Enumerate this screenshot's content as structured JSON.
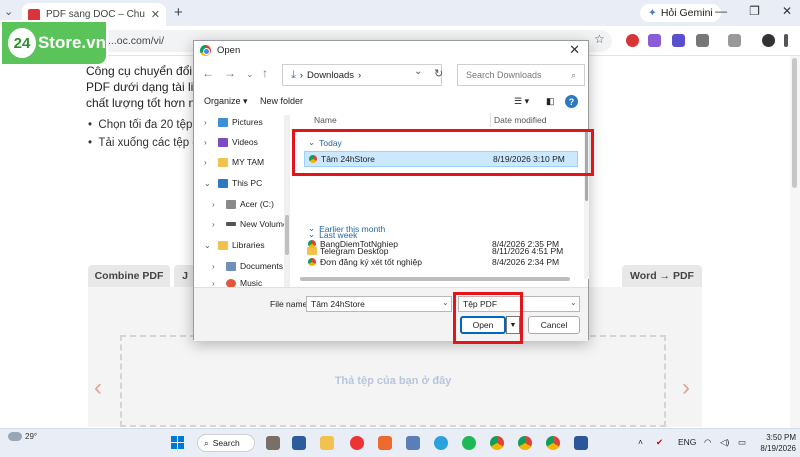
{
  "browser": {
    "tab_title": "PDF sang DOC – Chuyển đổi PDF",
    "url": "...oc.com/vi/",
    "gemini_label": "Hỏi Gemini"
  },
  "logo": {
    "number": "24",
    "text": "Store.vn"
  },
  "page": {
    "intro_lines": [
      "Công cụ chuyển đổi P",
      "PDF dưới dạng tài liệ",
      "chất lượng tốt hơn nh"
    ],
    "bullets": [
      "Chọn tối đa 20 tệp I",
      "Tải xuống các tệp đ"
    ],
    "tabs": {
      "combine": "Combine PDF",
      "partial": "J",
      "word_pdf": "Word → PDF"
    },
    "dropzone_text": "Thả tệp của bạn ở đây"
  },
  "dialog": {
    "title": "Open",
    "address": "Downloads",
    "search_placeholder": "Search Downloads",
    "organize": "Organize",
    "new_folder": "New folder",
    "tree": [
      "Pictures",
      "Videos",
      "MY TAM",
      "This PC",
      "Acer (C:)",
      "New Volume",
      "Libraries",
      "Documents",
      "Music"
    ],
    "columns": {
      "name": "Name",
      "date": "Date modified"
    },
    "groups": {
      "today": "Today",
      "last_week": "Last week",
      "earlier": "Earlier this month"
    },
    "files": [
      {
        "name": "Tâm 24hStore",
        "date": "8/19/2026 3:10 PM",
        "selected": true,
        "kind": "chrome"
      },
      {
        "name": "Telegram Desktop",
        "date": "8/11/2026 4:51 PM",
        "selected": false,
        "kind": "folder"
      },
      {
        "name": "BangDiemTotNghiep",
        "date": "8/4/2026 2:35 PM",
        "selected": false,
        "kind": "chrome"
      },
      {
        "name": "Đơn đăng ký xét tốt nghiệp",
        "date": "8/4/2026 2:34 PM",
        "selected": false,
        "kind": "chrome"
      }
    ],
    "file_name_label": "File name:",
    "file_name_value": "Tâm 24hStore",
    "file_type": "Tệp PDF",
    "open_label": "Open",
    "cancel_label": "Cancel"
  },
  "taskbar": {
    "weather": "29°",
    "search": "Search",
    "lang": "ENG",
    "time": "3:50 PM",
    "date": "8/19/2026"
  },
  "colors": {
    "highlight": "#e4141b",
    "selection": "#cce8ff",
    "brand_green": "#5ac35a"
  }
}
